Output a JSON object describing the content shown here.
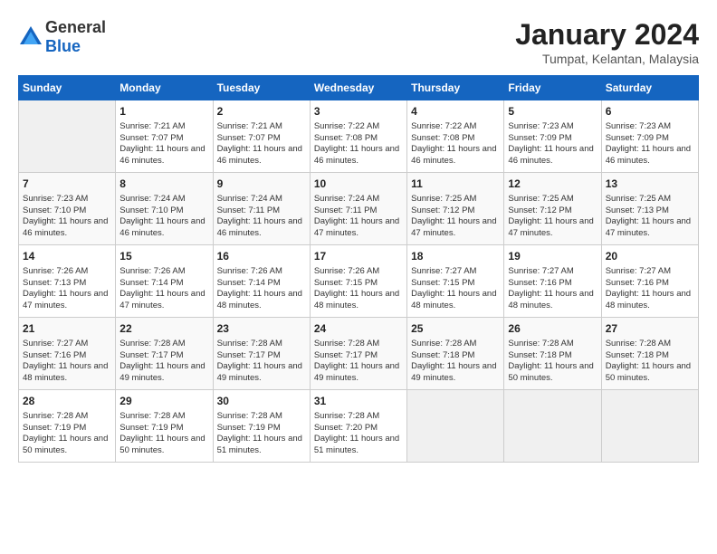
{
  "logo": {
    "general": "General",
    "blue": "Blue"
  },
  "header": {
    "title": "January 2024",
    "subtitle": "Tumpat, Kelantan, Malaysia"
  },
  "days_of_week": [
    "Sunday",
    "Monday",
    "Tuesday",
    "Wednesday",
    "Thursday",
    "Friday",
    "Saturday"
  ],
  "weeks": [
    [
      {
        "day": "",
        "content": ""
      },
      {
        "day": "1",
        "content": "Sunrise: 7:21 AM\nSunset: 7:07 PM\nDaylight: 11 hours\nand 46 minutes."
      },
      {
        "day": "2",
        "content": "Sunrise: 7:21 AM\nSunset: 7:07 PM\nDaylight: 11 hours\nand 46 minutes."
      },
      {
        "day": "3",
        "content": "Sunrise: 7:22 AM\nSunset: 7:08 PM\nDaylight: 11 hours\nand 46 minutes."
      },
      {
        "day": "4",
        "content": "Sunrise: 7:22 AM\nSunset: 7:08 PM\nDaylight: 11 hours\nand 46 minutes."
      },
      {
        "day": "5",
        "content": "Sunrise: 7:23 AM\nSunset: 7:09 PM\nDaylight: 11 hours\nand 46 minutes."
      },
      {
        "day": "6",
        "content": "Sunrise: 7:23 AM\nSunset: 7:09 PM\nDaylight: 11 hours\nand 46 minutes."
      }
    ],
    [
      {
        "day": "7",
        "content": "Sunrise: 7:23 AM\nSunset: 7:10 PM\nDaylight: 11 hours\nand 46 minutes."
      },
      {
        "day": "8",
        "content": "Sunrise: 7:24 AM\nSunset: 7:10 PM\nDaylight: 11 hours\nand 46 minutes."
      },
      {
        "day": "9",
        "content": "Sunrise: 7:24 AM\nSunset: 7:11 PM\nDaylight: 11 hours\nand 46 minutes."
      },
      {
        "day": "10",
        "content": "Sunrise: 7:24 AM\nSunset: 7:11 PM\nDaylight: 11 hours\nand 47 minutes."
      },
      {
        "day": "11",
        "content": "Sunrise: 7:25 AM\nSunset: 7:12 PM\nDaylight: 11 hours\nand 47 minutes."
      },
      {
        "day": "12",
        "content": "Sunrise: 7:25 AM\nSunset: 7:12 PM\nDaylight: 11 hours\nand 47 minutes."
      },
      {
        "day": "13",
        "content": "Sunrise: 7:25 AM\nSunset: 7:13 PM\nDaylight: 11 hours\nand 47 minutes."
      }
    ],
    [
      {
        "day": "14",
        "content": "Sunrise: 7:26 AM\nSunset: 7:13 PM\nDaylight: 11 hours\nand 47 minutes."
      },
      {
        "day": "15",
        "content": "Sunrise: 7:26 AM\nSunset: 7:14 PM\nDaylight: 11 hours\nand 47 minutes."
      },
      {
        "day": "16",
        "content": "Sunrise: 7:26 AM\nSunset: 7:14 PM\nDaylight: 11 hours\nand 48 minutes."
      },
      {
        "day": "17",
        "content": "Sunrise: 7:26 AM\nSunset: 7:15 PM\nDaylight: 11 hours\nand 48 minutes."
      },
      {
        "day": "18",
        "content": "Sunrise: 7:27 AM\nSunset: 7:15 PM\nDaylight: 11 hours\nand 48 minutes."
      },
      {
        "day": "19",
        "content": "Sunrise: 7:27 AM\nSunset: 7:16 PM\nDaylight: 11 hours\nand 48 minutes."
      },
      {
        "day": "20",
        "content": "Sunrise: 7:27 AM\nSunset: 7:16 PM\nDaylight: 11 hours\nand 48 minutes."
      }
    ],
    [
      {
        "day": "21",
        "content": "Sunrise: 7:27 AM\nSunset: 7:16 PM\nDaylight: 11 hours\nand 48 minutes."
      },
      {
        "day": "22",
        "content": "Sunrise: 7:28 AM\nSunset: 7:17 PM\nDaylight: 11 hours\nand 49 minutes."
      },
      {
        "day": "23",
        "content": "Sunrise: 7:28 AM\nSunset: 7:17 PM\nDaylight: 11 hours\nand 49 minutes."
      },
      {
        "day": "24",
        "content": "Sunrise: 7:28 AM\nSunset: 7:17 PM\nDaylight: 11 hours\nand 49 minutes."
      },
      {
        "day": "25",
        "content": "Sunrise: 7:28 AM\nSunset: 7:18 PM\nDaylight: 11 hours\nand 49 minutes."
      },
      {
        "day": "26",
        "content": "Sunrise: 7:28 AM\nSunset: 7:18 PM\nDaylight: 11 hours\nand 50 minutes."
      },
      {
        "day": "27",
        "content": "Sunrise: 7:28 AM\nSunset: 7:18 PM\nDaylight: 11 hours\nand 50 minutes."
      }
    ],
    [
      {
        "day": "28",
        "content": "Sunrise: 7:28 AM\nSunset: 7:19 PM\nDaylight: 11 hours\nand 50 minutes."
      },
      {
        "day": "29",
        "content": "Sunrise: 7:28 AM\nSunset: 7:19 PM\nDaylight: 11 hours\nand 50 minutes."
      },
      {
        "day": "30",
        "content": "Sunrise: 7:28 AM\nSunset: 7:19 PM\nDaylight: 11 hours\nand 51 minutes."
      },
      {
        "day": "31",
        "content": "Sunrise: 7:28 AM\nSunset: 7:20 PM\nDaylight: 11 hours\nand 51 minutes."
      },
      {
        "day": "",
        "content": ""
      },
      {
        "day": "",
        "content": ""
      },
      {
        "day": "",
        "content": ""
      }
    ]
  ]
}
